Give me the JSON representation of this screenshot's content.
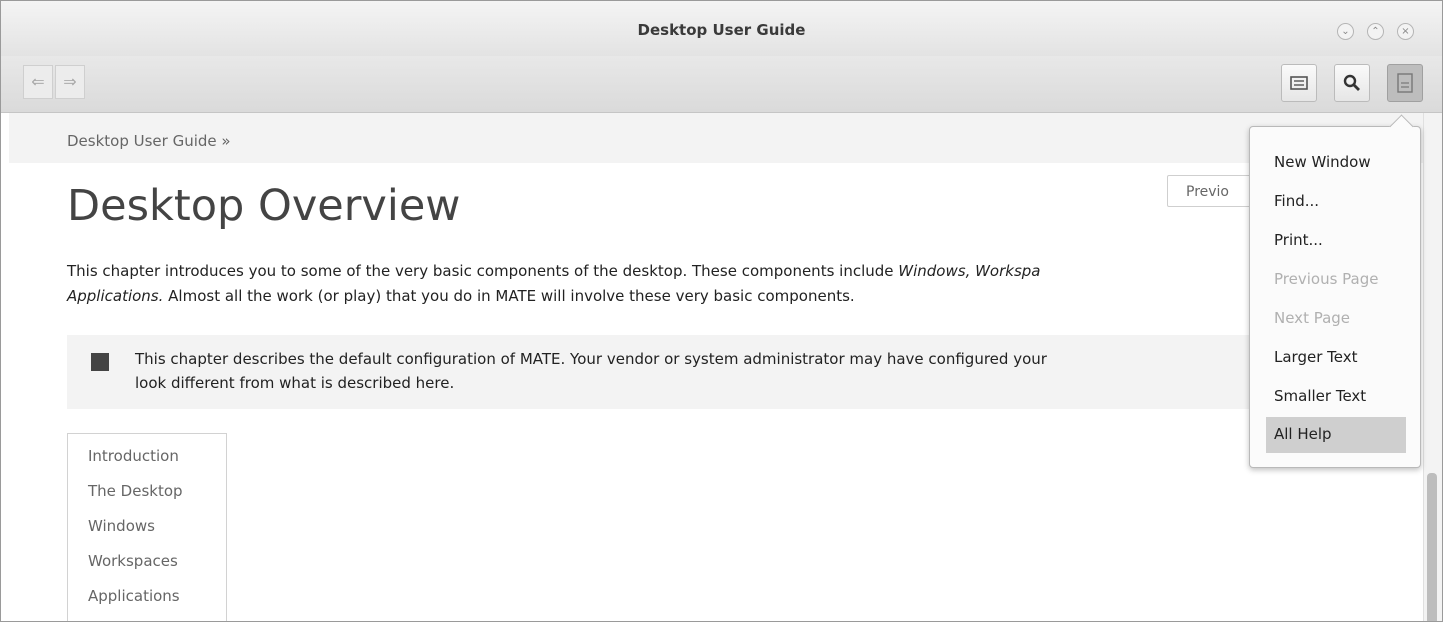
{
  "window": {
    "title": "Desktop User Guide"
  },
  "window_controls": [
    "minimize",
    "maximize",
    "close"
  ],
  "toolbar": {
    "back_icon": "back-arrow-icon",
    "forward_icon": "forward-arrow-icon",
    "bookmarks_icon": "bookmarks-icon",
    "search_icon": "search-icon",
    "menu_icon": "menu-icon"
  },
  "breadcrumb": "Desktop User Guide »",
  "page": {
    "title": "Desktop Overview",
    "prev_button": "Previo",
    "intro_line1": "This chapter introduces you to some of the very basic components of the desktop. These components include ",
    "intro_em1": "Windows, Workspa",
    "intro_em2": "Applications.",
    "intro_line2": " Almost all the work (or play) that you do in MATE will involve these very basic components.",
    "note_line1": "This chapter describes the default configuration of MATE. Your vendor or system administrator may have configured your",
    "note_line2": "look different from what is described here."
  },
  "toc": [
    "Introduction",
    "The Desktop",
    "Windows",
    "Workspaces",
    "Applications"
  ],
  "menu": {
    "items": [
      {
        "label": "New Window",
        "state": "enabled"
      },
      {
        "label": "Find...",
        "state": "enabled"
      },
      {
        "label": "Print...",
        "state": "enabled"
      },
      {
        "label": "Previous Page",
        "state": "disabled"
      },
      {
        "label": "Next Page",
        "state": "disabled"
      },
      {
        "label": "Larger Text",
        "state": "enabled"
      },
      {
        "label": "Smaller Text",
        "state": "enabled"
      },
      {
        "label": "All Help",
        "state": "highlighted"
      }
    ]
  },
  "colors": {
    "menu_highlight": "#cfcfcf",
    "note_background": "#f3f3f3",
    "disabled_text": "#b0b0b0"
  }
}
